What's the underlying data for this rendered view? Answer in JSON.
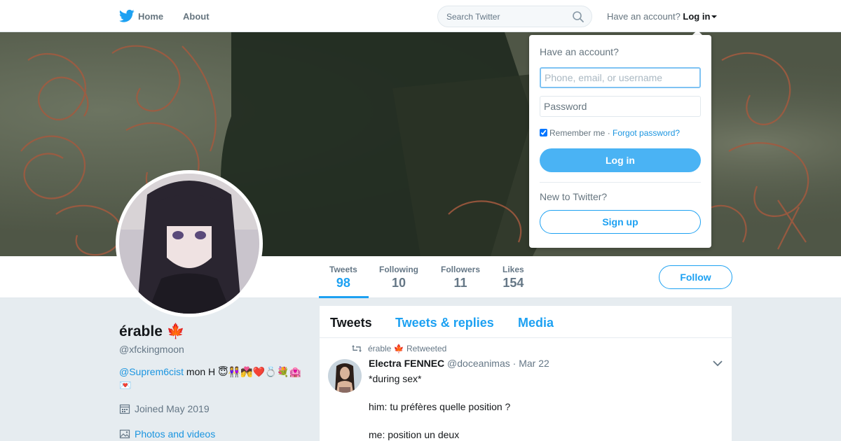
{
  "nav": {
    "home_label": "Home",
    "about_label": "About",
    "search_placeholder": "Search Twitter",
    "have_account_text": "Have an account?",
    "login_label": "Log in"
  },
  "profile": {
    "name": "érable 🍁",
    "handle": "@xfckingmoon",
    "bio_mention": "@Suprem6cist",
    "bio_text": " mon H 😇👭💏❤️💍💐🏩💌",
    "joined": "Joined May 2019",
    "photos_link": "Photos and videos",
    "follow_label": "Follow"
  },
  "stats": [
    {
      "label": "Tweets",
      "value": "98",
      "active": true
    },
    {
      "label": "Following",
      "value": "10"
    },
    {
      "label": "Followers",
      "value": "11"
    },
    {
      "label": "Likes",
      "value": "154"
    }
  ],
  "timeline": {
    "tabs": [
      "Tweets",
      "Tweets & replies",
      "Media"
    ],
    "active_tab": "Tweets",
    "tweet": {
      "retweet_note": "érable 🍁 Retweeted",
      "fullname": "Electra FENNEC",
      "username": "@doceanimas",
      "date": "· Mar 22",
      "lines": [
        "*during sex*",
        "",
        "him: tu préfères quelle position ?",
        "",
        "me: position un deux"
      ]
    }
  },
  "login_dropdown": {
    "title": "Have an account?",
    "username_placeholder": "Phone, email, or username",
    "password_placeholder": "Password",
    "remember_label": "Remember me",
    "separator": " · ",
    "forgot_label": "Forgot password?",
    "remember_checked": true,
    "login_button": "Log in",
    "new_text": "New to Twitter?",
    "signup_button": "Sign up"
  },
  "colors": {
    "accent": "#1da1f2",
    "login_button": "#4ab3f4",
    "background": "#e6ecf0"
  }
}
